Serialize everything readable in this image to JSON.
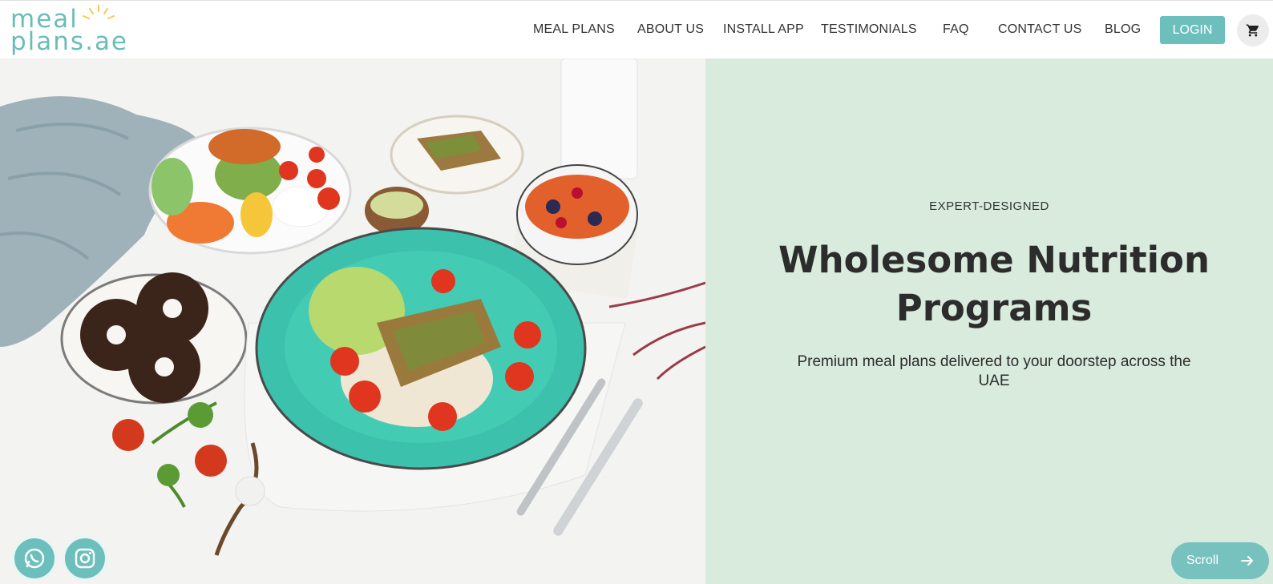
{
  "header": {
    "logo_line1": "meal",
    "logo_line2": "plans.ae",
    "nav": [
      "MEAL PLANS",
      "ABOUT US",
      "INSTALL APP",
      "TESTIMONIALS",
      "FAQ",
      "CONTACT US",
      "BLOG"
    ],
    "login_label": "LOGIN",
    "cart_icon": "cart-icon"
  },
  "hero": {
    "eyebrow": "EXPERT-DESIGNED",
    "headline": "Wholesome Nutrition Programs",
    "subline": "Premium meal plans delivered to your doorstep across the UAE",
    "scroll_label": "Scroll"
  },
  "social": {
    "icons": [
      "whatsapp-icon",
      "instagram-icon"
    ]
  },
  "colors": {
    "accent": "#6dbfbd",
    "panel": "#d8ebdd",
    "text": "#2c2c2c"
  }
}
